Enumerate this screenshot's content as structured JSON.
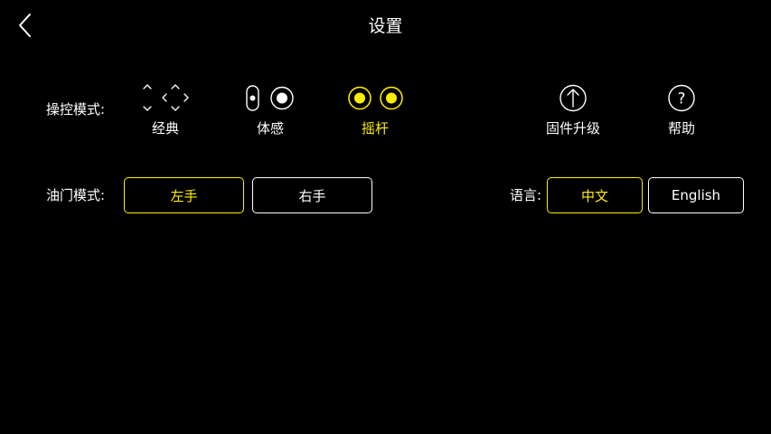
{
  "header": {
    "title": "设置"
  },
  "control_mode": {
    "label": "操控模式:",
    "options": [
      {
        "label": "经典",
        "icon": "dpad-arrows-icon",
        "active": false
      },
      {
        "label": "体感",
        "icon": "motion-toggle-icon",
        "active": false
      },
      {
        "label": "摇杆",
        "icon": "joystick-dots-icon",
        "active": true
      }
    ]
  },
  "extras": {
    "firmware": {
      "label": "固件升级",
      "icon": "upload-arrow-icon"
    },
    "help": {
      "label": "帮助",
      "icon": "question-circle-icon"
    }
  },
  "throttle_mode": {
    "label": "油门模式:",
    "options": [
      {
        "label": "左手",
        "active": true
      },
      {
        "label": "右手",
        "active": false
      }
    ]
  },
  "language": {
    "label": "语言:",
    "options": [
      {
        "label": "中文",
        "active": true
      },
      {
        "label": "English",
        "active": false
      }
    ]
  },
  "colors": {
    "background": "#000000",
    "text": "#ffffff",
    "accent": "#ffee00"
  }
}
